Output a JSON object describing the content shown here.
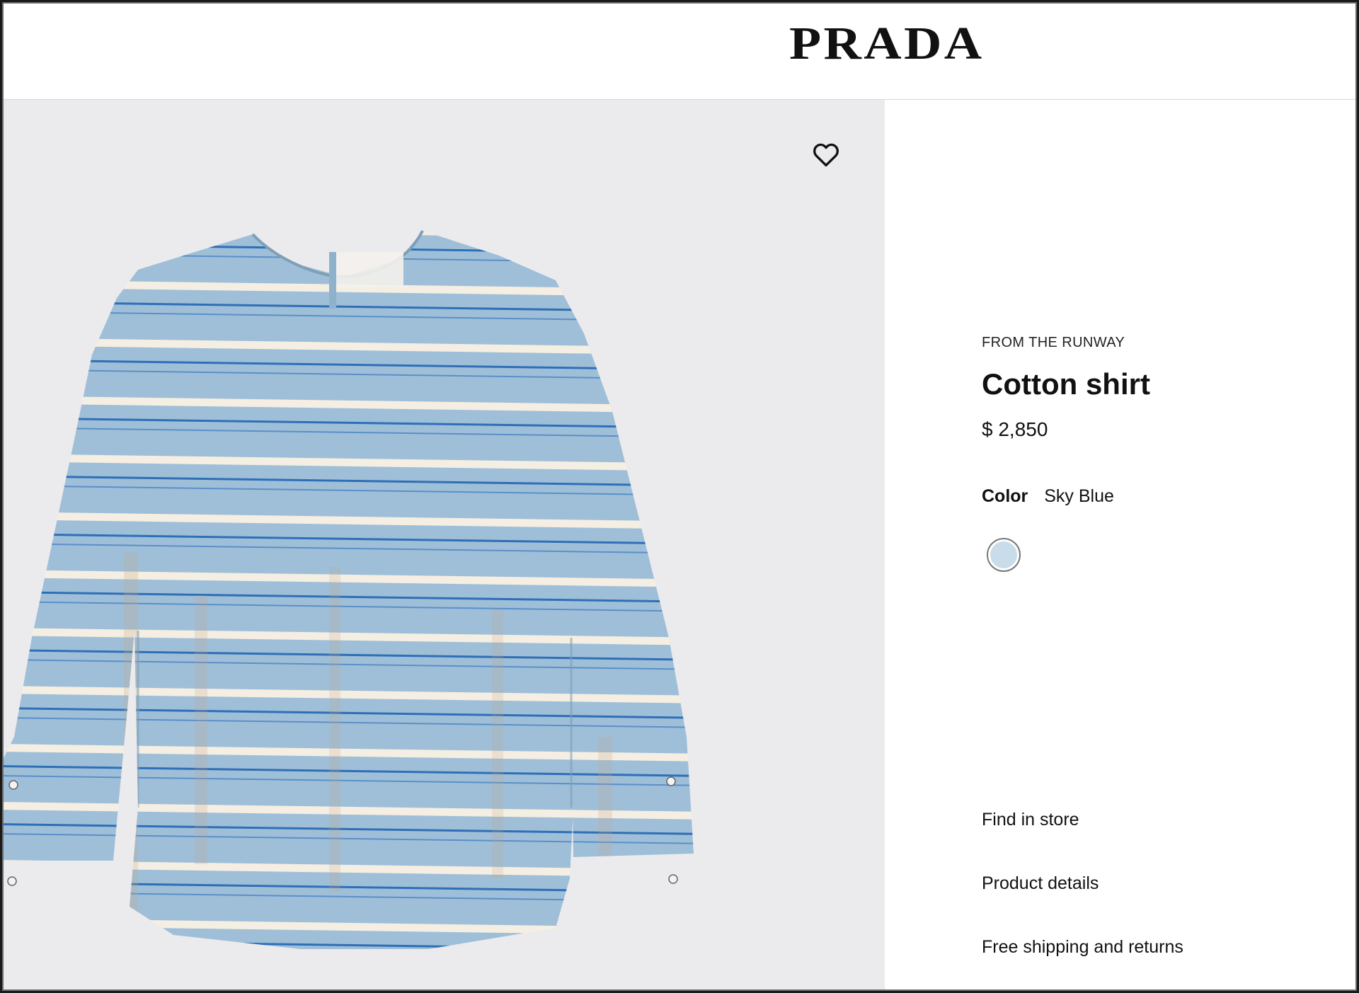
{
  "header": {
    "brand": "PRADA"
  },
  "gallery": {
    "wishlist_icon": "heart-outline-icon",
    "background_color": "#ebebed",
    "shirt_color": "#9fbfd8",
    "stripe_white": "#f5eee2",
    "stripe_blue": "#2f6fb6"
  },
  "product": {
    "eyebrow": "FROM THE RUNWAY",
    "title": "Cotton shirt",
    "price": "$ 2,850",
    "color_label": "Color",
    "color_value": "Sky Blue",
    "swatch_color": "#c9dcea"
  },
  "links": {
    "find_in_store": "Find in store",
    "product_details": "Product details",
    "shipping": "Free shipping and returns"
  }
}
